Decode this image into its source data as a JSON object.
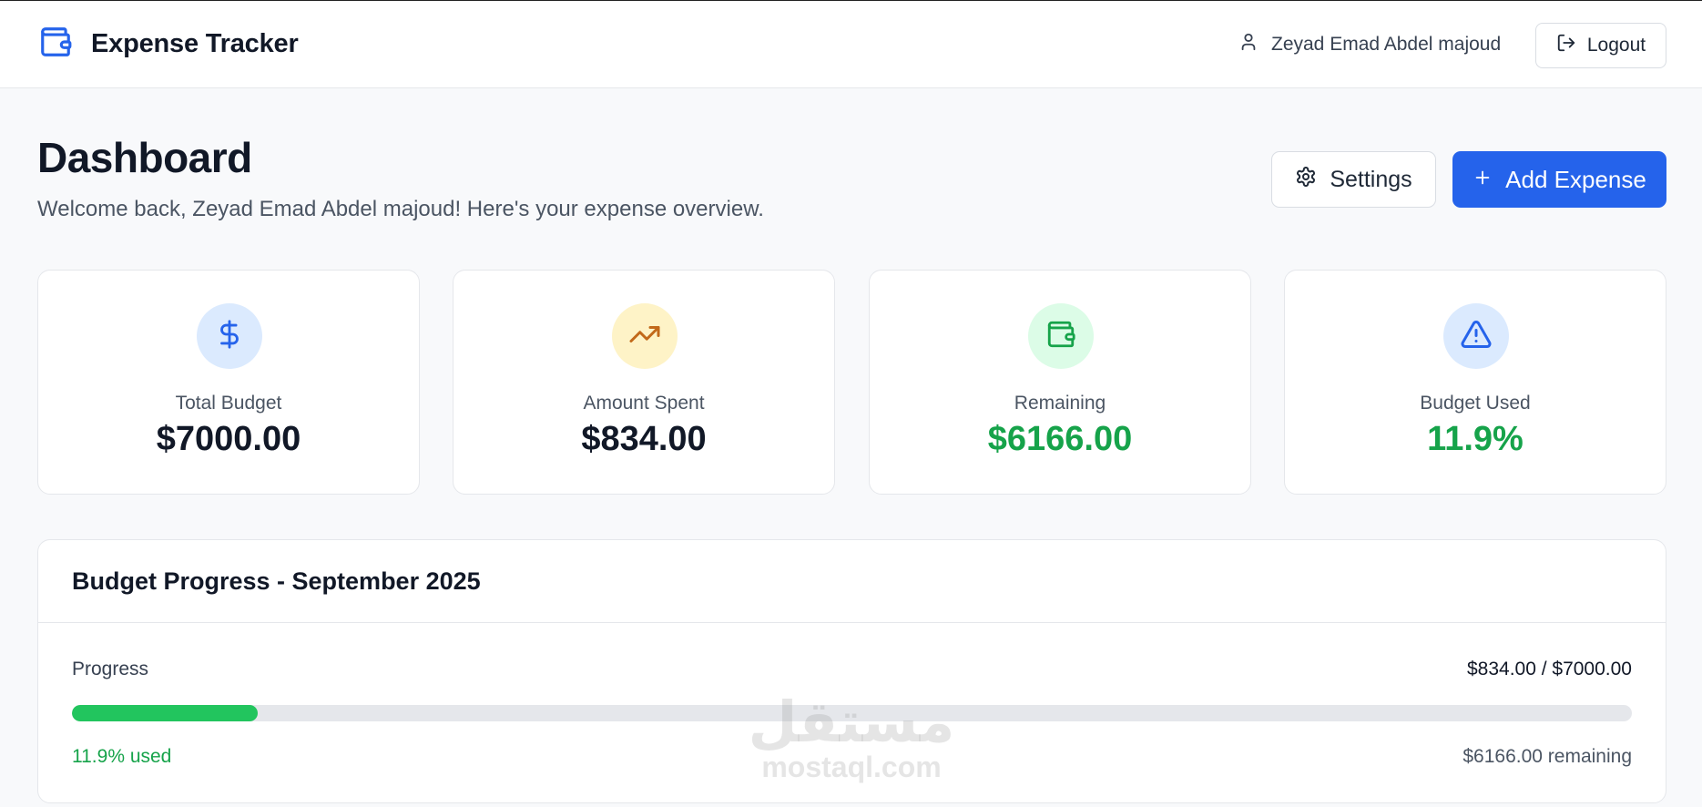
{
  "header": {
    "app_title": "Expense Tracker",
    "logo_icon": "wallet-icon",
    "user_name": "Zeyad Emad Abdel majoud",
    "user_icon": "user-icon",
    "logout_label": "Logout",
    "logout_icon": "logout-icon"
  },
  "page": {
    "title": "Dashboard",
    "subtitle": "Welcome back, Zeyad Emad Abdel majoud! Here's your expense overview.",
    "settings_label": "Settings",
    "settings_icon": "gear-icon",
    "add_expense_label": "Add Expense",
    "add_icon": "plus-icon"
  },
  "stats": [
    {
      "label": "Total Budget",
      "value": "$7000.00",
      "icon": "dollar-icon",
      "icon_bg": "#dbeafe",
      "icon_color": "#2563eb",
      "value_color": "#111827"
    },
    {
      "label": "Amount Spent",
      "value": "$834.00",
      "icon": "trending-up-icon",
      "icon_bg": "#fef3c7",
      "icon_color": "#c2691a",
      "value_color": "#111827"
    },
    {
      "label": "Remaining",
      "value": "$6166.00",
      "icon": "wallet-icon",
      "icon_bg": "#dcfce7",
      "icon_color": "#16a34a",
      "value_color": "#16a34a"
    },
    {
      "label": "Budget Used",
      "value": "11.9%",
      "icon": "warning-icon",
      "icon_bg": "#dbeafe",
      "icon_color": "#2563eb",
      "value_color": "#16a34a"
    }
  ],
  "progress": {
    "title": "Budget Progress - September 2025",
    "label": "Progress",
    "amount": "$834.00 / $7000.00",
    "fraction": 0.119,
    "used_text": "11.9% used",
    "remaining_text": "$6166.00 remaining"
  },
  "watermark": {
    "arabic": "مستقل",
    "latin": "mostaql.com"
  },
  "colors": {
    "accent": "#2563eb",
    "success": "#16a34a",
    "progress_fill": "#22c55e"
  }
}
